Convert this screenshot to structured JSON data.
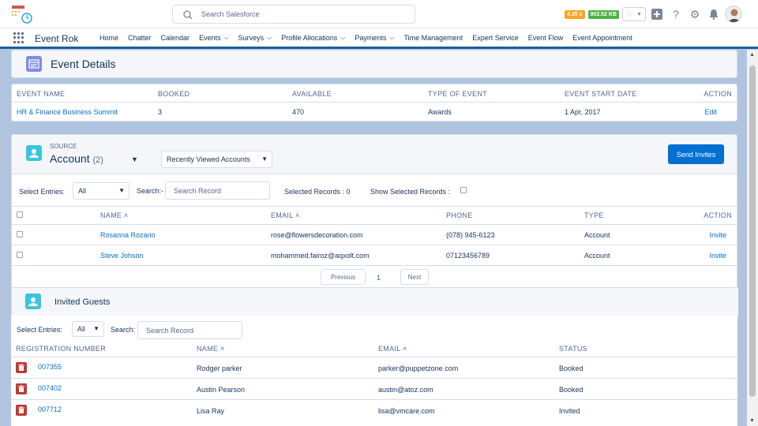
{
  "header": {
    "search_placeholder": "Search Salesforce",
    "badge_time": "4.35 s",
    "badge_size": "902.52 KB",
    "icons": [
      "add-icon",
      "help-icon",
      "setup-gear-icon",
      "notification-bell-icon"
    ]
  },
  "nav": {
    "app_name": "Event Rok",
    "items": [
      {
        "label": "Home",
        "dropdown": false
      },
      {
        "label": "Chatter",
        "dropdown": false
      },
      {
        "label": "Calendar",
        "dropdown": false
      },
      {
        "label": "Events",
        "dropdown": true
      },
      {
        "label": "Surveys",
        "dropdown": true
      },
      {
        "label": "Profile Allocations",
        "dropdown": true
      },
      {
        "label": "Payments",
        "dropdown": true
      },
      {
        "label": "Time Management",
        "dropdown": false
      },
      {
        "label": "Expert Service",
        "dropdown": false
      },
      {
        "label": "Event Flow",
        "dropdown": false
      },
      {
        "label": "Event Appointment",
        "dropdown": false
      }
    ]
  },
  "event_details": {
    "title": "Event Details",
    "columns": [
      "EVENT NAME",
      "BOOKED",
      "AVAILABLE",
      "TYPE OF EVENT",
      "EVENT START DATE",
      "ACTION"
    ],
    "row": {
      "event_name": "HR & Finance Business Summit",
      "booked": "3",
      "available": "470",
      "type": "Awards",
      "start_date": "1 Apr, 2017",
      "action": "Edit"
    }
  },
  "source": {
    "label": "SOURCE",
    "title": "Account",
    "count": "(2)",
    "list_view": "Recently Viewed Accounts",
    "send_button": "Send Invites",
    "select_entries_label": "Select Entries:",
    "select_entries_value": "All",
    "search_label": "Search:-",
    "search_placeholder": "Search Record",
    "selected_records": "Selected Records : 0",
    "show_selected_label": "Show Selected Records :",
    "columns": [
      "NAME",
      "EMAIL",
      "PHONE",
      "TYPE",
      "ACTION"
    ],
    "rows": [
      {
        "name": "Rosanna Rozario",
        "email": "rose@flowersdecoration.com",
        "phone": "(078) 945-6123",
        "type": "Account",
        "action": "Invite"
      },
      {
        "name": "Steve Johson",
        "email": "mohammed.fairoz@aqxolt.com",
        "phone": "07123456789",
        "type": "Account",
        "action": "Invite"
      }
    ],
    "pagination": {
      "previous": "Previous",
      "page": "1",
      "next": "Next"
    }
  },
  "invited": {
    "title": "Invited Guests",
    "select_entries_label": "Select Entries:",
    "select_entries_value": "All",
    "search_label": "Search:",
    "search_placeholder": "Search Record",
    "columns": [
      "REGISTRATION NUMBER",
      "NAME",
      "EMAIL",
      "STATUS"
    ],
    "rows": [
      {
        "reg": "007355",
        "name": "Rodger  parker",
        "email": "parker@puppetzone.com",
        "status": "Booked"
      },
      {
        "reg": "007402",
        "name": "Austin  Pearson",
        "email": "austin@atoz.com",
        "status": "Booked"
      },
      {
        "reg": "007712",
        "name": "Lisa  Ray",
        "email": "lisa@vmcare.com",
        "status": "Invited"
      }
    ]
  },
  "colors": {
    "brand_blue": "#0070d2",
    "nav_underline": "#1b5f9e",
    "delete_red": "#c23934",
    "event_icon": "#7f8de1",
    "account_icon": "#3bc4de",
    "badge_orange": "#f5a623",
    "badge_green": "#4bb543"
  }
}
